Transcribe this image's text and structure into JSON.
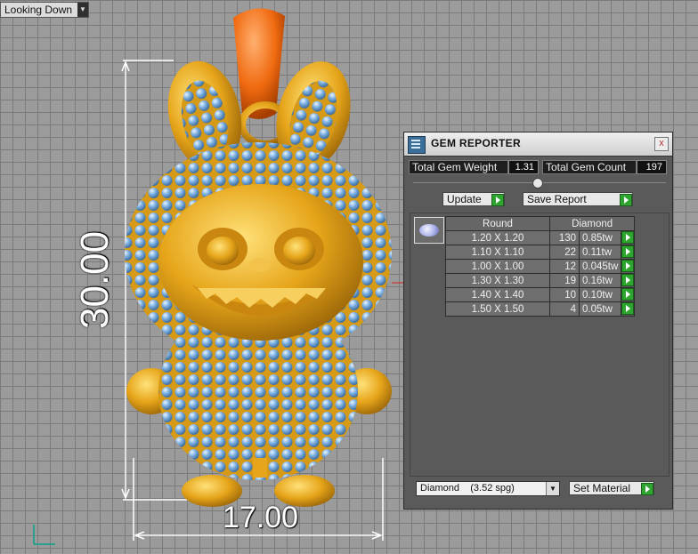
{
  "viewport": {
    "view_mode": "Looking Down",
    "dimension_height": "30.00",
    "dimension_width": "17.00",
    "colors": {
      "gold": "#e6a51a",
      "bail": "#f06a10",
      "gem": "#7aaee0",
      "grid": "#7b7b7b"
    }
  },
  "gem_reporter": {
    "title": "GEM REPORTER",
    "close_label": "x",
    "total_gem_weight_label": "Total Gem Weight",
    "total_gem_weight_value": "1.31",
    "total_gem_count_label": "Total Gem Count",
    "total_gem_count_value": "197",
    "update_label": "Update",
    "save_report_label": "Save Report",
    "table": {
      "header_shape": "Round",
      "header_material": "Diamond",
      "rows": [
        {
          "size": "1.20 X 1.20",
          "count": "130",
          "weight": "0.85tw"
        },
        {
          "size": "1.10 X 1.10",
          "count": "22",
          "weight": "0.11tw"
        },
        {
          "size": "1.00 X 1.00",
          "count": "12",
          "weight": "0.045tw"
        },
        {
          "size": "1.30 X 1.30",
          "count": "19",
          "weight": "0.16tw"
        },
        {
          "size": "1.40 X 1.40",
          "count": "10",
          "weight": "0.10tw"
        },
        {
          "size": "1.50 X 1.50",
          "count": "4",
          "weight": "0.05tw"
        }
      ]
    },
    "material_select": "Diamond    (3.52 spg)",
    "set_material_label": "Set Material"
  }
}
